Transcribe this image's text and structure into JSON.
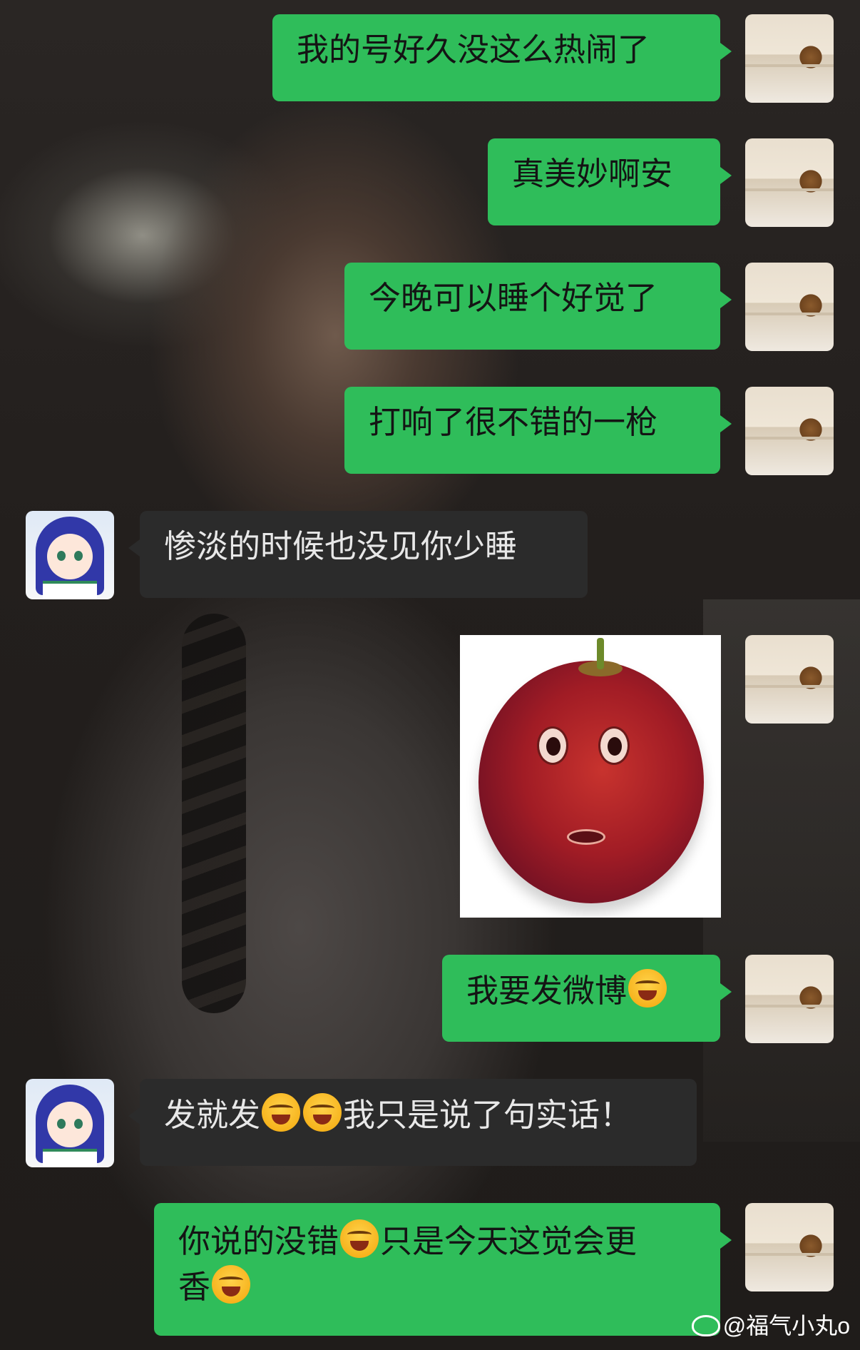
{
  "conversation": {
    "messages": [
      {
        "from": "me",
        "text": "我的号好久没这么热闹了"
      },
      {
        "from": "me",
        "text": "真美妙啊安"
      },
      {
        "from": "me",
        "text": "今晚可以睡个好觉了"
      },
      {
        "from": "me",
        "text": "打响了很不错的一枪"
      },
      {
        "from": "peer",
        "text": "惨淡的时候也没见你少睡"
      },
      {
        "from": "me",
        "type": "sticker",
        "sticker": "grape-face-sticker"
      },
      {
        "from": "me",
        "text": "我要发微博",
        "emoji": "grimacing-laugh-emoji"
      },
      {
        "from": "peer",
        "parts": [
          "发就发",
          "我只是说了句实话！"
        ],
        "emoji": "grimacing-laugh-emoji"
      },
      {
        "from": "me",
        "parts": [
          "你说的没错",
          "只是今天这觉会更",
          "香"
        ],
        "emoji": "grimacing-laugh-emoji"
      }
    ]
  },
  "watermark": {
    "text": "@福气小丸o",
    "icon": "weibo-logo-icon"
  },
  "colors": {
    "my_bubble": "#2fbd5a",
    "peer_bubble": "#2b2b2b",
    "peer_text": "#e8e8e8"
  }
}
